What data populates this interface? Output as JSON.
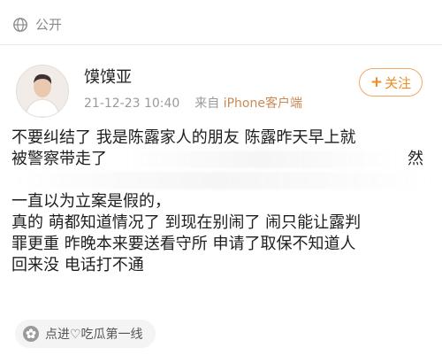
{
  "header": {
    "visibility_label": "公开",
    "visibility_icon": "globe-icon"
  },
  "post": {
    "username": "馍馍亚",
    "timestamp": "21-12-23 10:40",
    "source_prefix": "来自",
    "source_client": "iPhone客户端",
    "follow_label": "关注",
    "content_lines": [
      "不要纠结了 我是陈露家人的朋友 陈露昨天早上就",
      "被警察带走了",
      "然",
      "一直以为立案是假的，",
      "真的 萌都知道情况了 到现在别闹了 闹只能让露判",
      "罪更重 昨晚本来要送看守所 申请了取保不知道人",
      "回来没 电话打不通"
    ],
    "tag_label": "点进♡吃瓜第一线",
    "tag_icon": "flower-icon"
  },
  "colors": {
    "accent": "#f08a22",
    "muted": "#9a9a9a",
    "source": "#c98a55"
  }
}
